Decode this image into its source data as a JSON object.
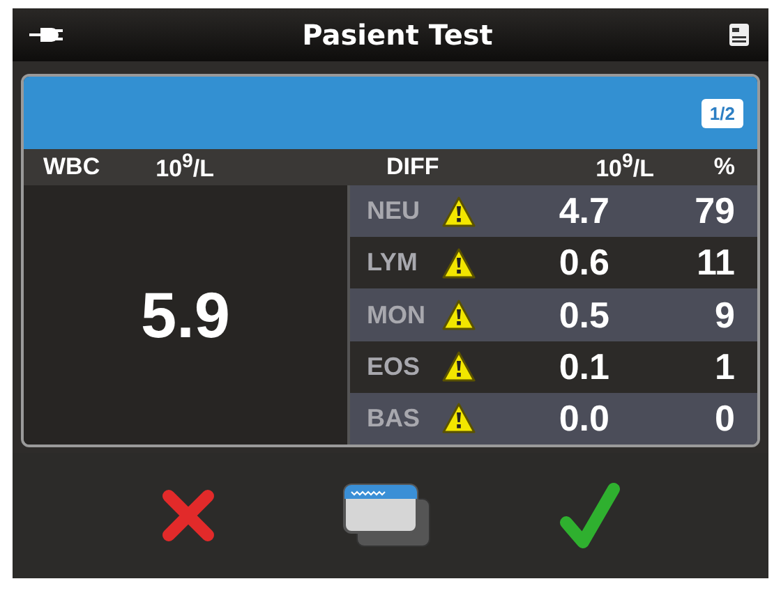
{
  "window": {
    "title": "Pasient Test"
  },
  "page_badge": "1/2",
  "header": {
    "wbc_label": "WBC",
    "wbc_unit": "10$^{9}$/L",
    "diff_label": "DIFF",
    "diff_unit": "10$^{9}$/L",
    "percent_label": "%"
  },
  "wbc_value": "5.9",
  "rows": [
    {
      "name": "NEU",
      "warning": true,
      "value": "4.7",
      "percent": "79"
    },
    {
      "name": "LYM",
      "warning": true,
      "value": "0.6",
      "percent": "11"
    },
    {
      "name": "MON",
      "warning": true,
      "value": "0.5",
      "percent": "9"
    },
    {
      "name": "EOS",
      "warning": true,
      "value": "0.1",
      "percent": "1"
    },
    {
      "name": "BAS",
      "warning": true,
      "value": "0.0",
      "percent": "0"
    }
  ]
}
